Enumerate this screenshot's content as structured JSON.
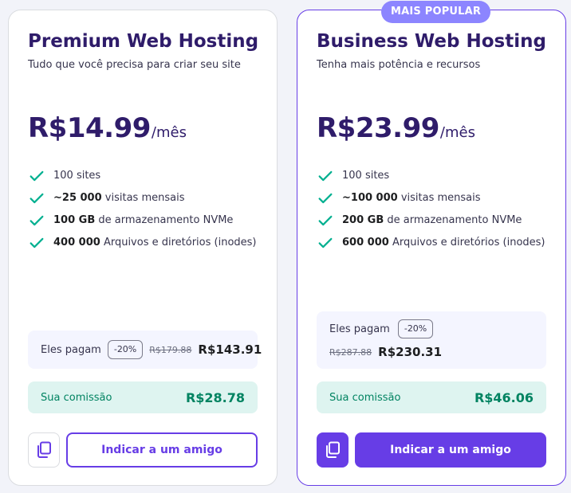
{
  "colors": {
    "primary": "#673de6",
    "title": "#2f1c6a",
    "badge": "#8c85ff",
    "check": "#00b090",
    "commission_bg": "#def4f0",
    "commission_text": "#008361",
    "pay_bg": "#f4f5ff"
  },
  "plans": [
    {
      "title": "Premium Web Hosting",
      "subtitle": "Tudo que você precisa para criar seu site",
      "price": "R$14.99",
      "period": "/mês",
      "features": [
        {
          "bold": "",
          "text": "100 sites"
        },
        {
          "bold": "~25 000",
          "text": " visitas mensais"
        },
        {
          "bold": "100 GB",
          "text": " de armazenamento NVMe"
        },
        {
          "bold": "400 000",
          "text": " Arquivos e diretórios (inodes)"
        }
      ],
      "pay_label": "Eles pagam",
      "discount": "-20%",
      "old_price": "R$179.88",
      "new_price": "R$143.91",
      "commission_label": "Sua comissão",
      "commission_value": "R$28.78",
      "copy_icon": "copy-icon",
      "refer_label": "Indicar a um amigo"
    },
    {
      "badge": "MAIS POPULAR",
      "title": "Business Web Hosting",
      "subtitle": "Tenha mais potência e recursos",
      "price": "R$23.99",
      "period": "/mês",
      "features": [
        {
          "bold": "",
          "text": "100 sites"
        },
        {
          "bold": "~100 000",
          "text": " visitas mensais"
        },
        {
          "bold": "200 GB",
          "text": " de armazenamento NVMe"
        },
        {
          "bold": "600 000",
          "text": " Arquivos e diretórios (inodes)"
        }
      ],
      "pay_label": "Eles pagam",
      "discount": "-20%",
      "old_price": "R$287.88",
      "new_price": "R$230.31",
      "commission_label": "Sua comissão",
      "commission_value": "R$46.06",
      "copy_icon": "copy-icon",
      "refer_label": "Indicar a um amigo"
    }
  ]
}
